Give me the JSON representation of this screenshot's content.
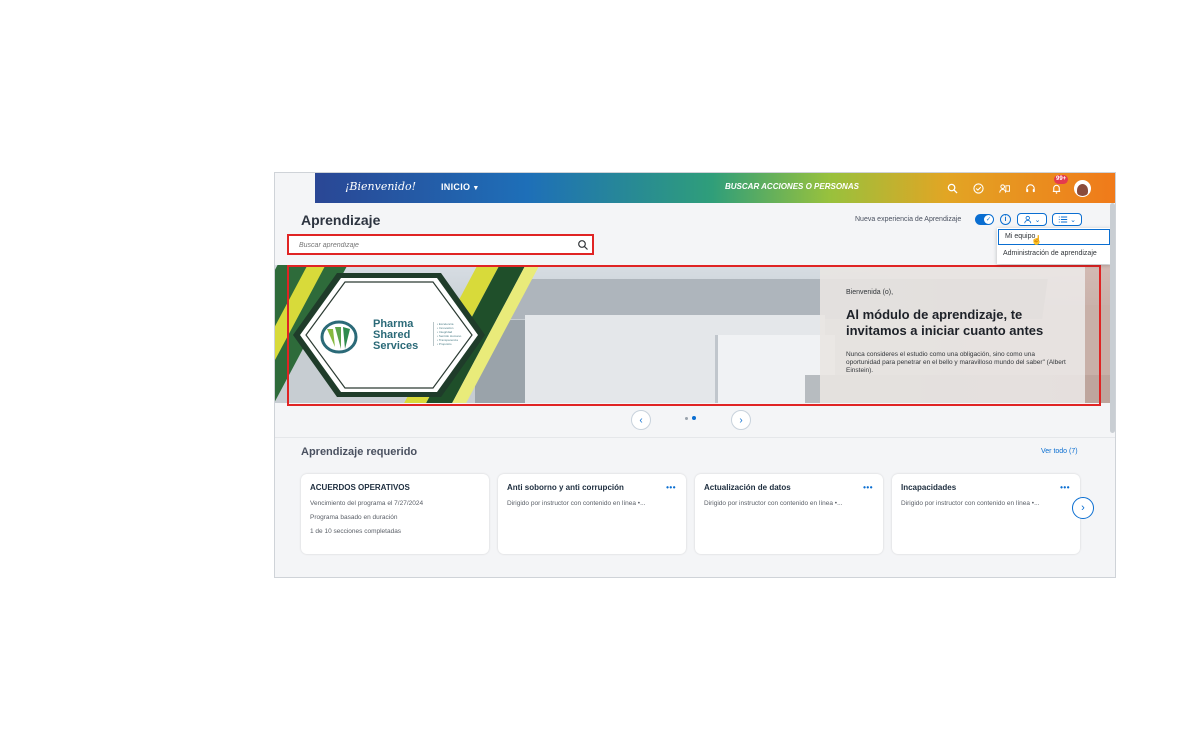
{
  "topbar": {
    "logo": "¡Bienvenido!",
    "home_label": "INICIO",
    "search_actions": "BUSCAR ACCIONES O PERSONAS",
    "notifications_badge": "99+"
  },
  "header": {
    "title": "Aprendizaje",
    "search_placeholder": "Buscar aprendizaje",
    "new_experience_label": "Nueva experiencia de Aprendizaje"
  },
  "dropdown": {
    "items": [
      "Mi equipo",
      "Administración de aprendizaje"
    ]
  },
  "banner": {
    "brand_lines": [
      "Pharma",
      "Shared",
      "Services"
    ],
    "brand_values": [
      "• Excelencia",
      "• Innovación",
      "• Integridad",
      "• Sentido Humano",
      "• Transparencia",
      "• Propósito"
    ],
    "greeting": "Bienvenida (o),",
    "headline": "Al módulo de aprendizaje, te invitamos a iniciar cuanto antes",
    "quote": "Nunca consideres el estudio como una obligación, sino como una oportunidad para penetrar en el bello y maravilloso mundo del saber\" (Albert Einstein)."
  },
  "section": {
    "title": "Aprendizaje requerido",
    "see_all": "Ver todo (7)"
  },
  "cards": [
    {
      "title": "ACUERDOS OPERATIVOS",
      "lines": [
        "Vencimiento del programa el 7/27/2024",
        "Programa basado en duración",
        "1 de 10 secciones completadas"
      ]
    },
    {
      "title": "Anti soborno y anti corrupción",
      "lines": [
        "Dirigido por instructor con contenido en línea •..."
      ]
    },
    {
      "title": "Actualización de datos",
      "lines": [
        "Dirigido por instructor con contenido en línea •..."
      ]
    },
    {
      "title": "Incapacidades",
      "lines": [
        "Dirigido por instructor con contenido en línea •..."
      ]
    }
  ],
  "colors": {
    "accent": "#0a6ed1",
    "highlight_border": "#e02424"
  }
}
